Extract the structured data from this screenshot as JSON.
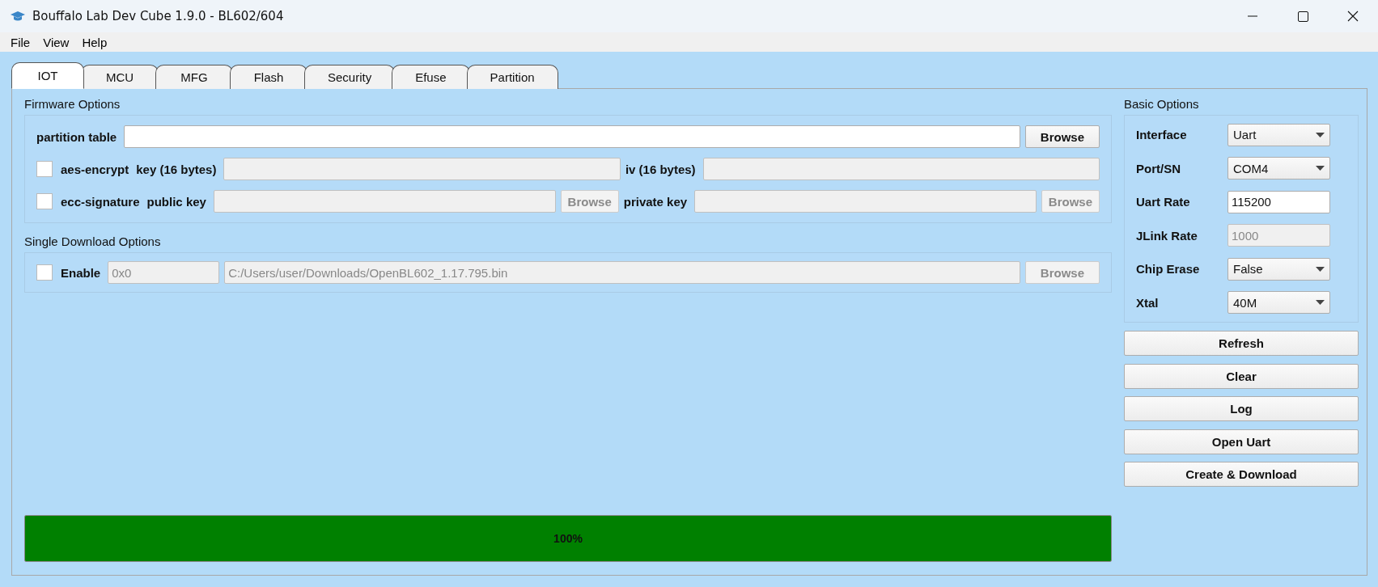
{
  "window": {
    "title": "Bouffalo Lab Dev Cube 1.9.0 - BL602/604"
  },
  "menu": [
    {
      "label": "File"
    },
    {
      "label": "View"
    },
    {
      "label": "Help"
    }
  ],
  "tabs": [
    {
      "label": "IOT",
      "selected": true
    },
    {
      "label": "MCU",
      "selected": false
    },
    {
      "label": "MFG",
      "selected": false
    },
    {
      "label": "Flash",
      "selected": false
    },
    {
      "label": "Security",
      "selected": false
    },
    {
      "label": "Efuse",
      "selected": false
    },
    {
      "label": "Partition",
      "selected": false
    }
  ],
  "firmware_options": {
    "title": "Firmware Options",
    "partition_table": {
      "label": "partition table",
      "button": "Browse"
    },
    "aes": {
      "label": "aes-encrypt",
      "checked": false,
      "key_label": "key (16 bytes)",
      "iv_label": "iv (16 bytes)",
      "disabled": true
    },
    "ecc": {
      "label": "ecc-signature",
      "checked": false,
      "public_key_label": "public key",
      "public_browse": "Browse",
      "private_key_label": "private key",
      "private_browse": "Browse",
      "disabled": true
    }
  },
  "single_download": {
    "title": "Single Download Options",
    "enable": {
      "label": "Enable",
      "checked": false
    },
    "address": "0x0",
    "file": "C:/Users/user/Downloads/OpenBL602_1.17.795.bin",
    "browse": "Browse",
    "disabled": true
  },
  "basic_options": {
    "title": "Basic Options",
    "fields": [
      {
        "label": "Interface",
        "kind": "combo",
        "value": "Uart"
      },
      {
        "label": "Port/SN",
        "kind": "combo",
        "value": "COM4"
      },
      {
        "label": "Uart Rate",
        "kind": "text",
        "value": "115200",
        "disabled": false
      },
      {
        "label": "JLink Rate",
        "kind": "text",
        "value": "1000",
        "disabled": true
      },
      {
        "label": "Chip Erase",
        "kind": "combo",
        "value": "False"
      },
      {
        "label": "Xtal",
        "kind": "combo",
        "value": "40M"
      }
    ]
  },
  "buttons": [
    {
      "label": "Refresh"
    },
    {
      "label": "Clear"
    },
    {
      "label": "Log"
    },
    {
      "label": "Open Uart"
    },
    {
      "label": "Create & Download"
    }
  ],
  "progress": {
    "level": 1,
    "label": "100%"
  }
}
